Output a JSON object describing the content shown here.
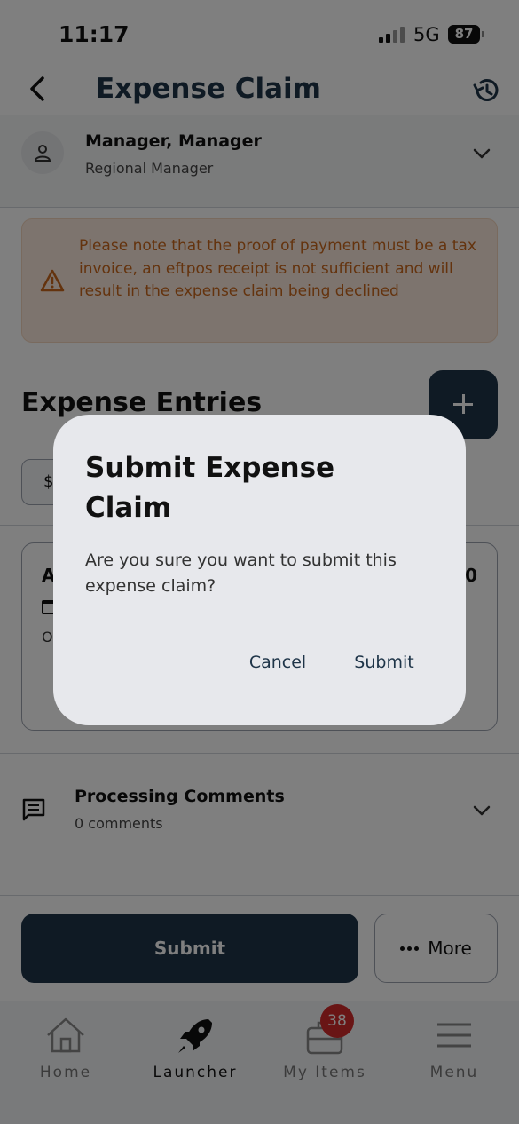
{
  "status_bar": {
    "time": "11:17",
    "network": "5G",
    "battery": "87"
  },
  "header": {
    "title": "Expense Claim"
  },
  "manager": {
    "name": "Manager, Manager",
    "role": "Regional Manager"
  },
  "warning": {
    "text": "Please note that the proof of payment must be a tax invoice, an eftpos receipt is not sufficient and will result in the expense claim being declined"
  },
  "entries": {
    "title": "Expense Entries",
    "filter_chip": "$",
    "card": {
      "first_letter": "A",
      "amount_tail": "0",
      "line2": "O"
    }
  },
  "comments": {
    "title": "Processing Comments",
    "count": "0 comments"
  },
  "actions": {
    "submit": "Submit",
    "more": "More"
  },
  "tabs": [
    {
      "label": "Home",
      "icon": "home-icon"
    },
    {
      "label": "Launcher",
      "icon": "rocket-icon"
    },
    {
      "label": "My Items",
      "icon": "briefcase-icon",
      "badge": "38"
    },
    {
      "label": "Menu",
      "icon": "hamburger-icon"
    }
  ],
  "dialog": {
    "title": "Submit Expense Claim",
    "message": "Are you sure you want to submit this expense claim?",
    "cancel": "Cancel",
    "submit": "Submit"
  },
  "colors": {
    "primary": "#1e3448",
    "warning_bg": "#fbe9dc",
    "warning_text": "#c9671c",
    "badge": "#d32a2a"
  }
}
